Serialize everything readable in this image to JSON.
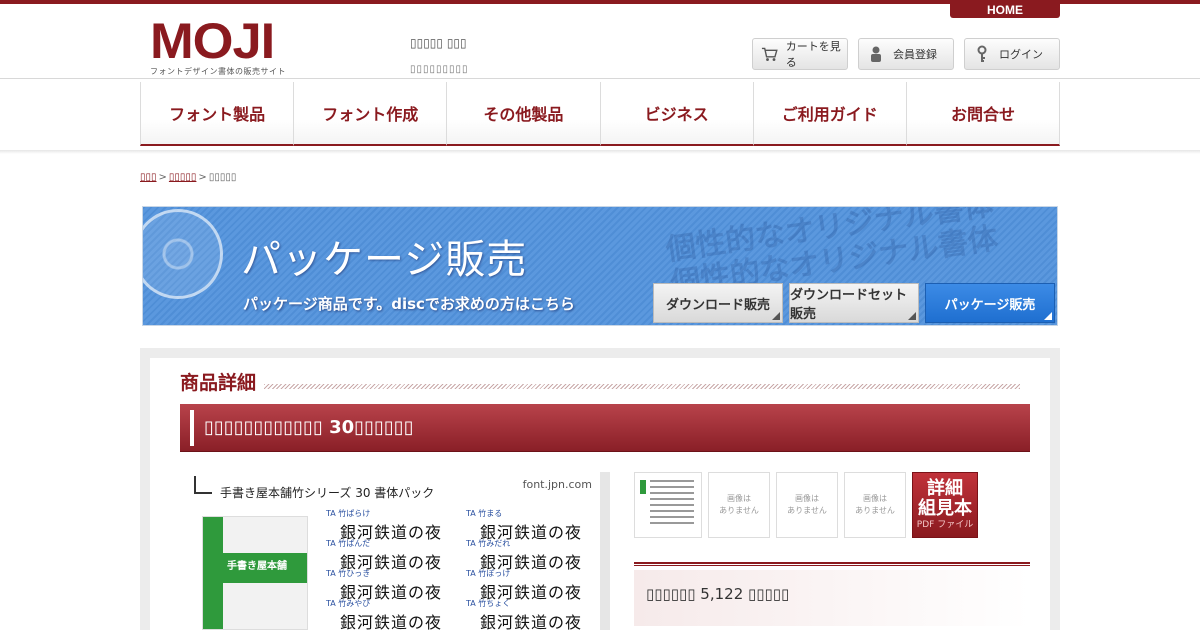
{
  "header": {
    "home_label": "HOME",
    "logo_text": "MOJI",
    "logo_sub": "フォントデザイン書体の販売サイト",
    "tagline": "▯▯▯▯▯ ▯▯▯",
    "tagline2": "▯▯▯▯▯▯▯▯▯",
    "cart_label": "カートを見る",
    "register_label": "会員登録",
    "login_label": "ログイン"
  },
  "nav": {
    "items": [
      {
        "label": "フォント製品"
      },
      {
        "label": "フォント作成"
      },
      {
        "label": "その他製品"
      },
      {
        "label": "ビジネス"
      },
      {
        "label": "ご利用ガイド"
      },
      {
        "label": "お問合せ"
      }
    ]
  },
  "breadcrumb": {
    "home": "▯▯▯",
    "sep1": ">",
    "category": "▯▯▯▯▯",
    "sep2": ">",
    "current": "▯▯▯▯▯"
  },
  "banner": {
    "title": "パッケージ販売",
    "subtitle": "パッケージ商品です。discでお求めの方はこちら",
    "bg_text": "個性的なオリジナル書体",
    "tabs": [
      {
        "label": "ダウンロード販売"
      },
      {
        "label": "ダウンロードセット販売"
      },
      {
        "label": "パッケージ販売"
      }
    ]
  },
  "section": {
    "title": "商品詳細"
  },
  "product": {
    "title": "▯▯▯▯▯▯▯▯▯▯▯▯ 30▯▯▯▯▯▯",
    "image_caption": "手書き屋本舗竹シリーズ 30 書体パック",
    "image_site": "font.jpn.com",
    "package_label": "手書き屋本舗",
    "samples": [
      {
        "name": "TA 竹ぱらけ",
        "text": "銀河鉄道の夜"
      },
      {
        "name": "TA 竹まる",
        "text": "銀河鉄道の夜"
      },
      {
        "name": "TA 竹ぱんだ",
        "text": "銀河鉄道の夜"
      },
      {
        "name": "TA 竹みだれ",
        "text": "銀河鉄道の夜"
      },
      {
        "name": "TA 竹ひっき",
        "text": "銀河鉄道の夜"
      },
      {
        "name": "TA 竹ぽっけ",
        "text": "銀河鉄道の夜"
      },
      {
        "name": "TA 竹みやび",
        "text": "銀河鉄道の夜"
      },
      {
        "name": "TA 竹ちょく",
        "text": "銀河鉄道の夜"
      }
    ],
    "thumbs": {
      "no_image": "画像は\nありません",
      "pdf_big1": "詳細",
      "pdf_big2": "組見本",
      "pdf_small": "PDF ファイル"
    },
    "price": "▯▯▯▯▯▯ 5,122 ▯▯▯▯▯"
  },
  "colors": {
    "brand": "#8a1a1f",
    "banner_blue": "#4f8ed6",
    "active_tab": "#1f6fd0"
  }
}
